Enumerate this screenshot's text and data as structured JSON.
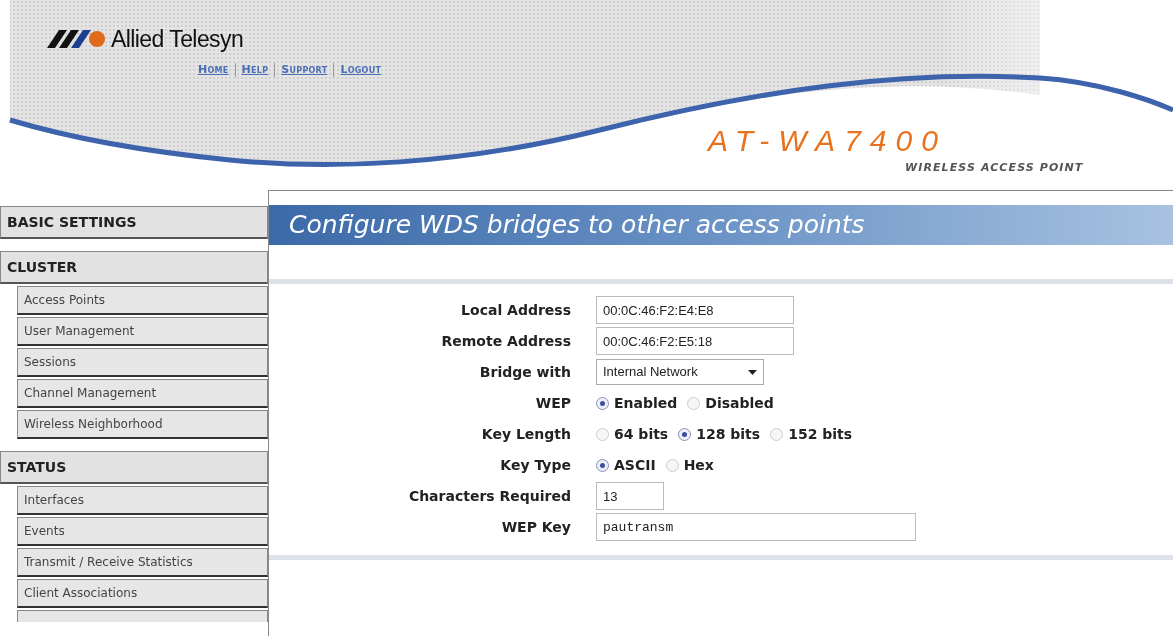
{
  "header": {
    "brand": "Allied Telesyn",
    "nav_links": [
      "Home",
      "Help",
      "Support",
      "Logout"
    ],
    "product_model": "AT-WA7400",
    "product_subtitle": "WIRELESS ACCESS POINT"
  },
  "sidebar": {
    "sections": [
      {
        "title": "BASIC SETTINGS"
      },
      {
        "title": "CLUSTER",
        "items": [
          "Access Points",
          "User Management",
          "Sessions",
          "Channel Management",
          "Wireless Neighborhood"
        ]
      },
      {
        "title": "STATUS",
        "items": [
          "Interfaces",
          "Events",
          "Transmit / Receive Statistics",
          "Client Associations"
        ]
      }
    ]
  },
  "page_title": "Configure WDS bridges to other access points",
  "form": [
    {
      "kind": "text",
      "label": "Local Address",
      "value": "00:0C:46:F2:E4:E8"
    },
    {
      "kind": "text",
      "label": "Remote Address",
      "value": "00:0C:46:F2:E5:18"
    },
    {
      "kind": "select",
      "label": "Bridge with",
      "value": "Internal Network"
    },
    {
      "kind": "radio",
      "label": "WEP",
      "options": [
        {
          "label": "Enabled",
          "selected": true
        },
        {
          "label": "Disabled",
          "selected": false
        }
      ]
    },
    {
      "kind": "radio",
      "label": "Key Length",
      "options": [
        {
          "label": "64 bits",
          "selected": false
        },
        {
          "label": "128 bits",
          "selected": true
        },
        {
          "label": "152 bits",
          "selected": false
        }
      ]
    },
    {
      "kind": "radio",
      "label": "Key Type",
      "options": [
        {
          "label": "ASCII",
          "selected": true
        },
        {
          "label": "Hex",
          "selected": false
        }
      ]
    },
    {
      "kind": "short_text",
      "label": "Characters Required",
      "value": "13"
    },
    {
      "kind": "long_text",
      "label": "WEP Key",
      "value": "pautransm"
    }
  ]
}
